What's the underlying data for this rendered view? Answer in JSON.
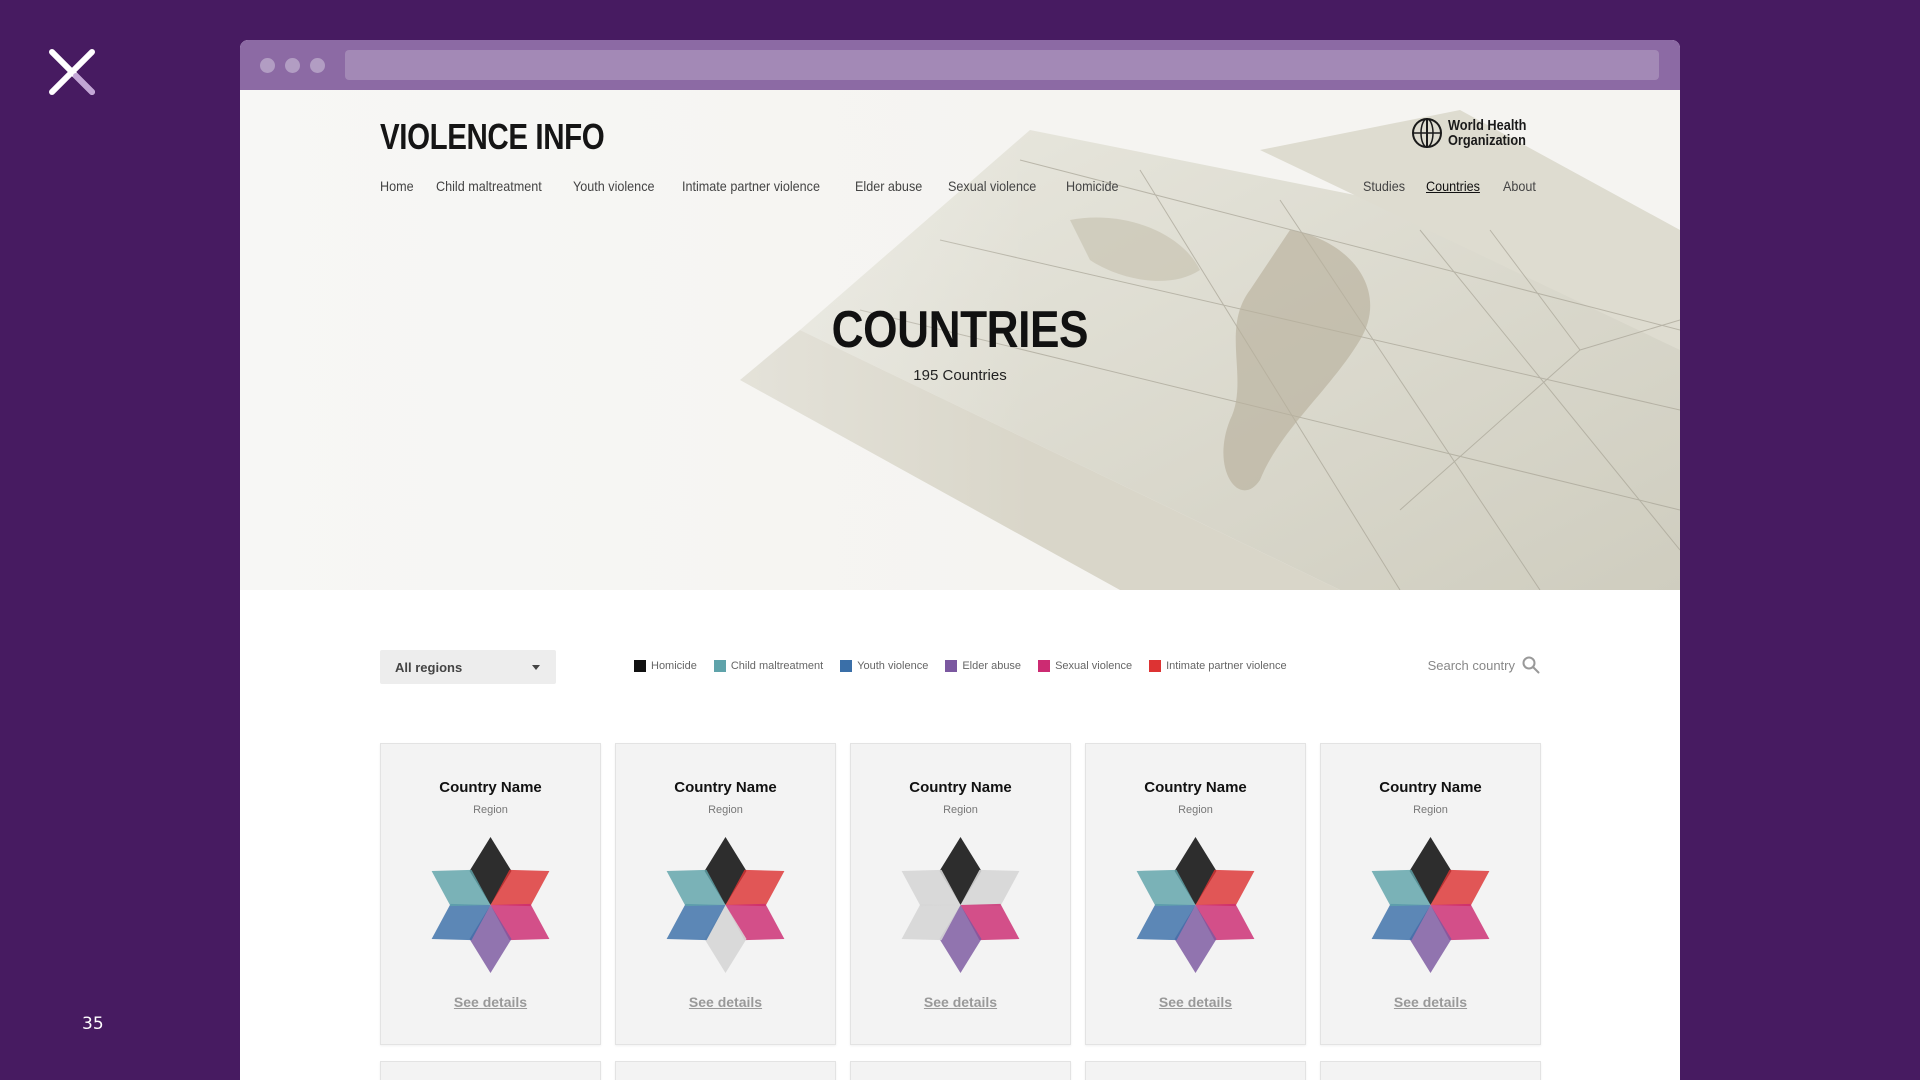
{
  "slide": {
    "number": "35"
  },
  "site": {
    "title": "VIOLENCE INFO",
    "nav_left": [
      "Home",
      "Child maltreatment",
      "Youth violence",
      "Intimate partner violence",
      "Elder abuse",
      "Sexual violence",
      "Homicide"
    ],
    "nav_right": [
      "Studies",
      "Countries",
      "About"
    ],
    "active_nav": "Countries",
    "org_logo_text": [
      "World Health",
      "Organization"
    ]
  },
  "hero": {
    "title": "COUNTRIES",
    "subtitle": "195 Countries"
  },
  "filters": {
    "region_select": "All regions",
    "search_placeholder": "Search country",
    "legend": [
      {
        "label": "Homicide",
        "color": "#111111"
      },
      {
        "label": "Child maltreatment",
        "color": "#5fa3aa"
      },
      {
        "label": "Youth violence",
        "color": "#3a6fa8"
      },
      {
        "label": "Elder abuse",
        "color": "#7b58a0"
      },
      {
        "label": "Sexual violence",
        "color": "#cc2b72"
      },
      {
        "label": "Intimate partner violence",
        "color": "#dd3333"
      }
    ]
  },
  "cards": [
    {
      "name": "Country Name",
      "region": "Region",
      "link": "See details",
      "data_available": [
        true,
        true,
        true,
        true,
        true,
        true
      ]
    },
    {
      "name": "Country Name",
      "region": "Region",
      "link": "See details",
      "data_available": [
        true,
        true,
        true,
        false,
        true,
        true
      ]
    },
    {
      "name": "Country Name",
      "region": "Region",
      "link": "See details",
      "data_available": [
        true,
        false,
        false,
        true,
        true,
        false
      ]
    },
    {
      "name": "Country Name",
      "region": "Region",
      "link": "See details",
      "data_available": [
        true,
        true,
        true,
        true,
        true,
        true
      ]
    },
    {
      "name": "Country Name",
      "region": "Region",
      "link": "See details",
      "data_available": [
        true,
        true,
        true,
        true,
        true,
        true
      ]
    }
  ]
}
